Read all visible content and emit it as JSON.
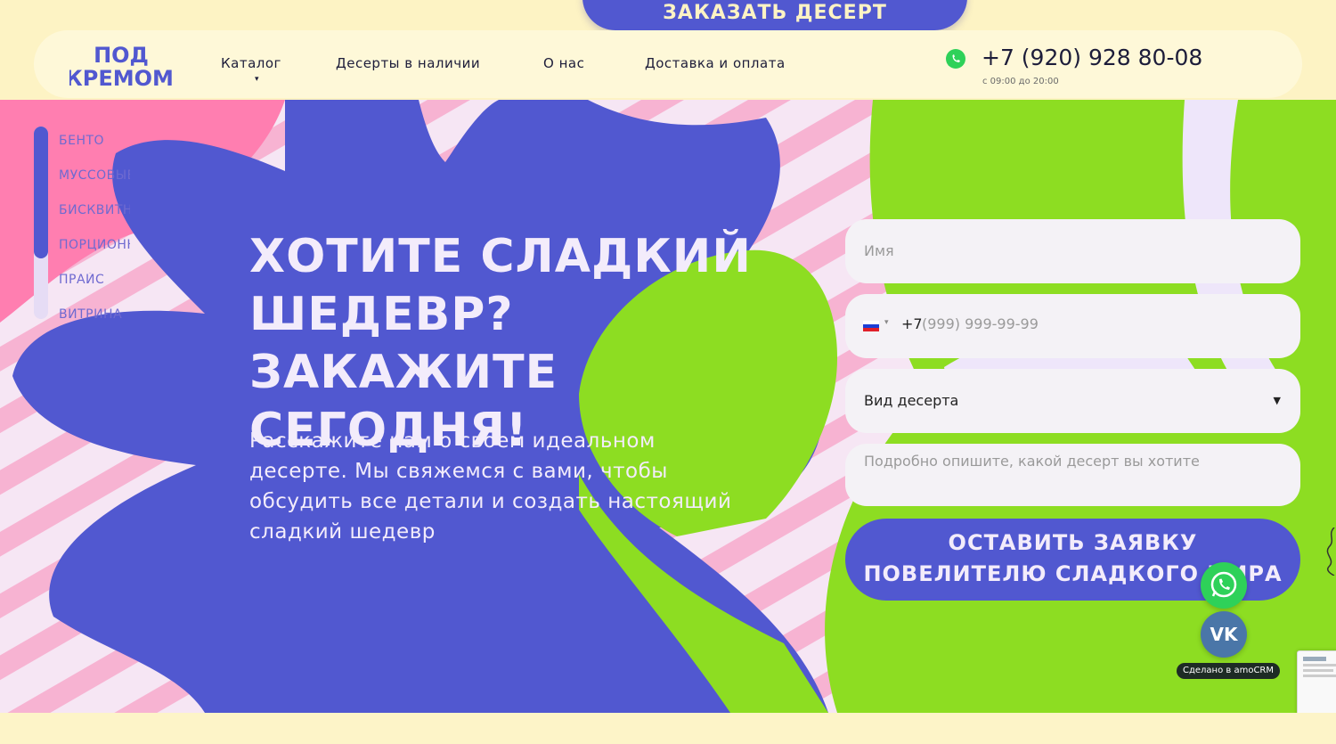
{
  "brand": {
    "logo_line1": "ПОД",
    "logo_line2": "КРЕМОМ",
    "colors": {
      "primary": "#5158d0",
      "accent_green": "#8ddd22",
      "accent_pink": "#ff7eb0",
      "cream": "#fdf4c8"
    }
  },
  "top_button": {
    "label": "ЗАКАЗАТЬ ДЕСЕРТ"
  },
  "nav": {
    "items": [
      {
        "label": "Каталог"
      },
      {
        "label": "Десерты в наличии"
      },
      {
        "label": "О нас"
      },
      {
        "label": "Доставка и оплата"
      }
    ],
    "catalog_caret": "▾"
  },
  "contact": {
    "whatsapp_icon": "whatsapp-icon",
    "phone": "+7 (920) 928 80-08",
    "hours": "с 09:00 до 20:00"
  },
  "sidebar": {
    "items": [
      {
        "label": "БЕНТО"
      },
      {
        "label": "МУССОВЫЕ"
      },
      {
        "label": "БИСКВИТНЫЕ"
      },
      {
        "label": "ПОРЦИОННЫЕ"
      },
      {
        "label": "ПРАЙС"
      },
      {
        "label": "ВИТРИНА"
      }
    ]
  },
  "hero": {
    "title_line1": "Хотите сладкий",
    "title_line2": "шедевр?",
    "title_line3": "Закажите сегодня!",
    "subtitle": "Расскажите нам о своем идеальном десерте. Мы свяжемся с вами, чтобы обсудить все детали и создать настоящий сладкий шедевр"
  },
  "form": {
    "name_placeholder": "Имя",
    "phone_prefix": "+7",
    "phone_placeholder": "(999) 999-99-99",
    "flag_caret": "▾",
    "dessert_type_value": "Вид десерта",
    "select_caret": "▼",
    "details_placeholder": "Подробно опишите, какой десерт вы хотите",
    "submit_line1": "Оставить заявку",
    "submit_line2": "повелителю сладкого мира"
  },
  "floating": {
    "vk_label": "VK",
    "amocrm_label": "Сделано в amoCRM"
  }
}
